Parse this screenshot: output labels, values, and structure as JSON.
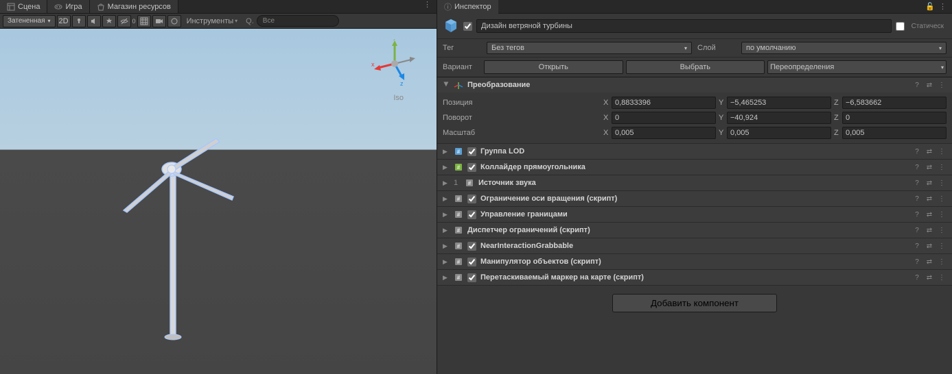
{
  "tabs": {
    "scene": "Сцена",
    "game": "Игра",
    "assetStore": "Магазин ресурсов"
  },
  "sceneToolbar": {
    "shading": "Затененная",
    "mode2d": "2D",
    "tools": "Инструменты",
    "searchPrefix": "Q.",
    "searchText": "Все"
  },
  "viewport": {
    "projection": "Iso",
    "axisX": "x",
    "axisY": "y",
    "axisZ": "z"
  },
  "inspector": {
    "title": "Инспектор",
    "objectName": "Дизайн ветряной турбины",
    "staticLabel": "Статическ",
    "tagLabel": "Тег",
    "tagValue": "Без тегов",
    "layerLabel": "Слой",
    "layerValue": "по умолчанию",
    "variantLabel": "Вариант",
    "openBtn": "Открыть",
    "selectBtn": "Выбрать",
    "overridesBtn": "Переопределения"
  },
  "transform": {
    "title": "Преобразование",
    "positionLabel": "Позиция",
    "rotationLabel": "Поворот",
    "scaleLabel": "Масштаб",
    "position": {
      "x": "0,8833396",
      "y": "−5,465253",
      "z": "−6,583662"
    },
    "rotation": {
      "x": "0",
      "y": "−40,924",
      "z": "0"
    },
    "scale": {
      "x": "0,005",
      "y": "0,005",
      "z": "0,005"
    }
  },
  "components": [
    {
      "name": "Группа LOD",
      "checked": true,
      "iconColor": "#5a9fd4"
    },
    {
      "name": "Коллайдер прямоугольника",
      "checked": true,
      "iconColor": "#7cb342"
    },
    {
      "name": "Источник звука",
      "checked": null,
      "prefix": "1"
    },
    {
      "name": "Ограничение оси вращения (скрипт)",
      "checked": true,
      "iconColor": "#888"
    },
    {
      "name": "Управление границами",
      "checked": true,
      "iconColor": "#888"
    },
    {
      "name": "Диспетчер ограничений (скрипт)",
      "checked": null,
      "iconColor": "#888"
    },
    {
      "name": "NearInteractionGrabbable",
      "checked": true,
      "iconColor": "#888"
    },
    {
      "name": "Манипулятор объектов (скрипт)",
      "checked": true,
      "iconColor": "#888"
    },
    {
      "name": "Перетаскиваемый маркер на карте (скрипт)",
      "checked": true,
      "iconColor": "#888"
    }
  ],
  "addComponentBtn": "Добавить компонент"
}
